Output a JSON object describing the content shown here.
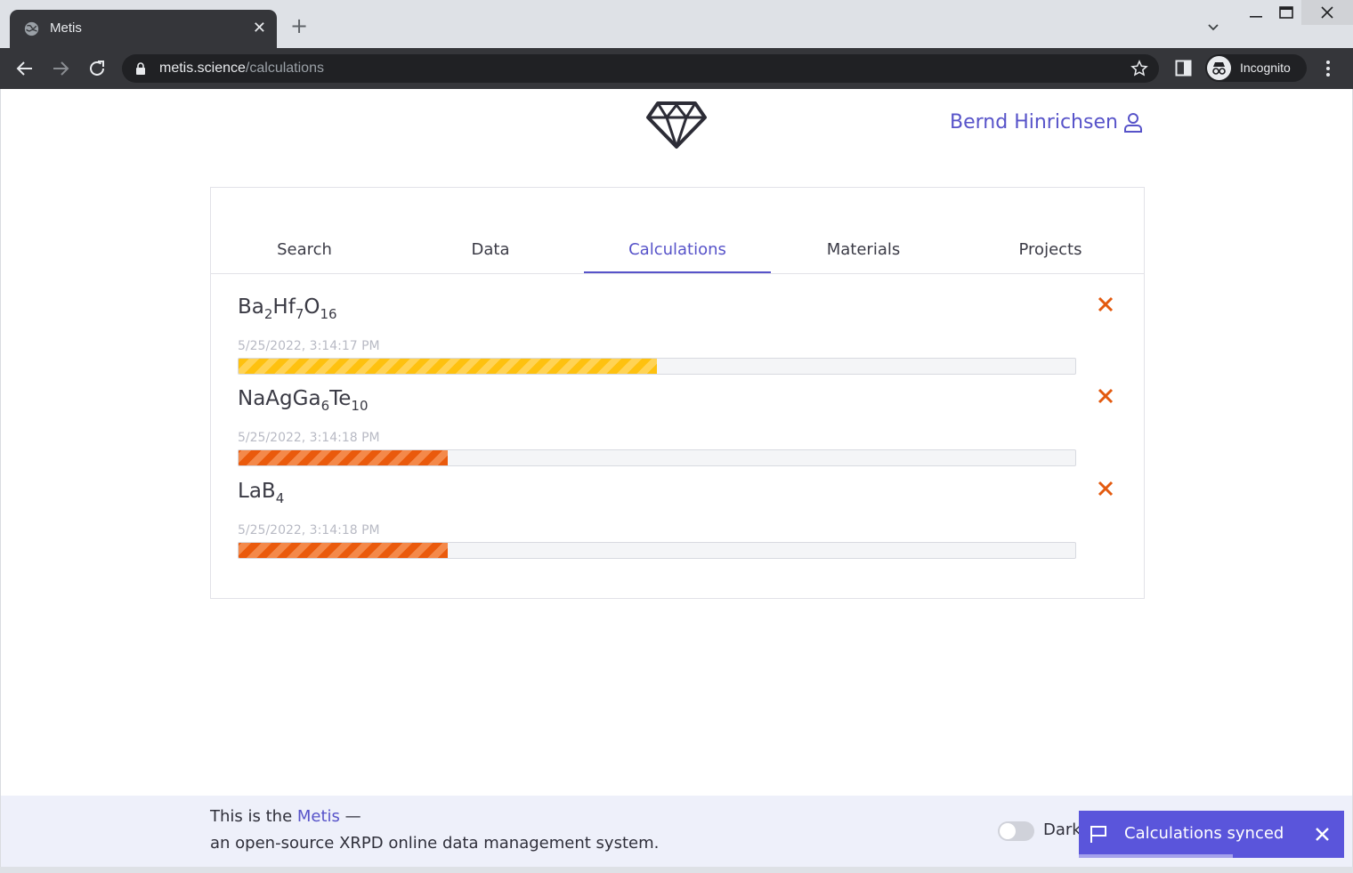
{
  "browser": {
    "tab_title": "Metis",
    "url_host": "metis.science",
    "url_path": "/calculations",
    "profile_label": "Incognito"
  },
  "header": {
    "user_name": "Bernd Hinrichsen"
  },
  "nav": {
    "tabs": [
      {
        "label": "Search"
      },
      {
        "label": "Data"
      },
      {
        "label": "Calculations"
      },
      {
        "label": "Materials"
      },
      {
        "label": "Projects"
      }
    ],
    "active": "Calculations"
  },
  "calculations": [
    {
      "formula_parts": [
        [
          "Ba",
          "2"
        ],
        [
          "Hf",
          "7"
        ],
        [
          "O",
          "16"
        ]
      ],
      "timestamp": "5/25/2022, 3:14:17 PM",
      "progress": 0.5,
      "status_color": "#fec10f"
    },
    {
      "formula_parts": [
        [
          "NaAgGa",
          "6"
        ],
        [
          "Te",
          "10"
        ]
      ],
      "timestamp": "5/25/2022, 3:14:18 PM",
      "progress": 0.25,
      "status_color": "#ea5a0c"
    },
    {
      "formula_parts": [
        [
          "LaB",
          "4"
        ]
      ],
      "timestamp": "5/25/2022, 3:14:18 PM",
      "progress": 0.25,
      "status_color": "#ea5a0c"
    }
  ],
  "footer": {
    "prefix": "This is the ",
    "link": "Metis",
    "suffix": " —",
    "line2": "an open-source XRPD online data management system.",
    "dark_label": "Dark"
  },
  "toast": {
    "message": "Calculations synced"
  },
  "colors": {
    "accent": "#5753c9",
    "remove": "#e35a0f",
    "toast": "#5a55db"
  }
}
